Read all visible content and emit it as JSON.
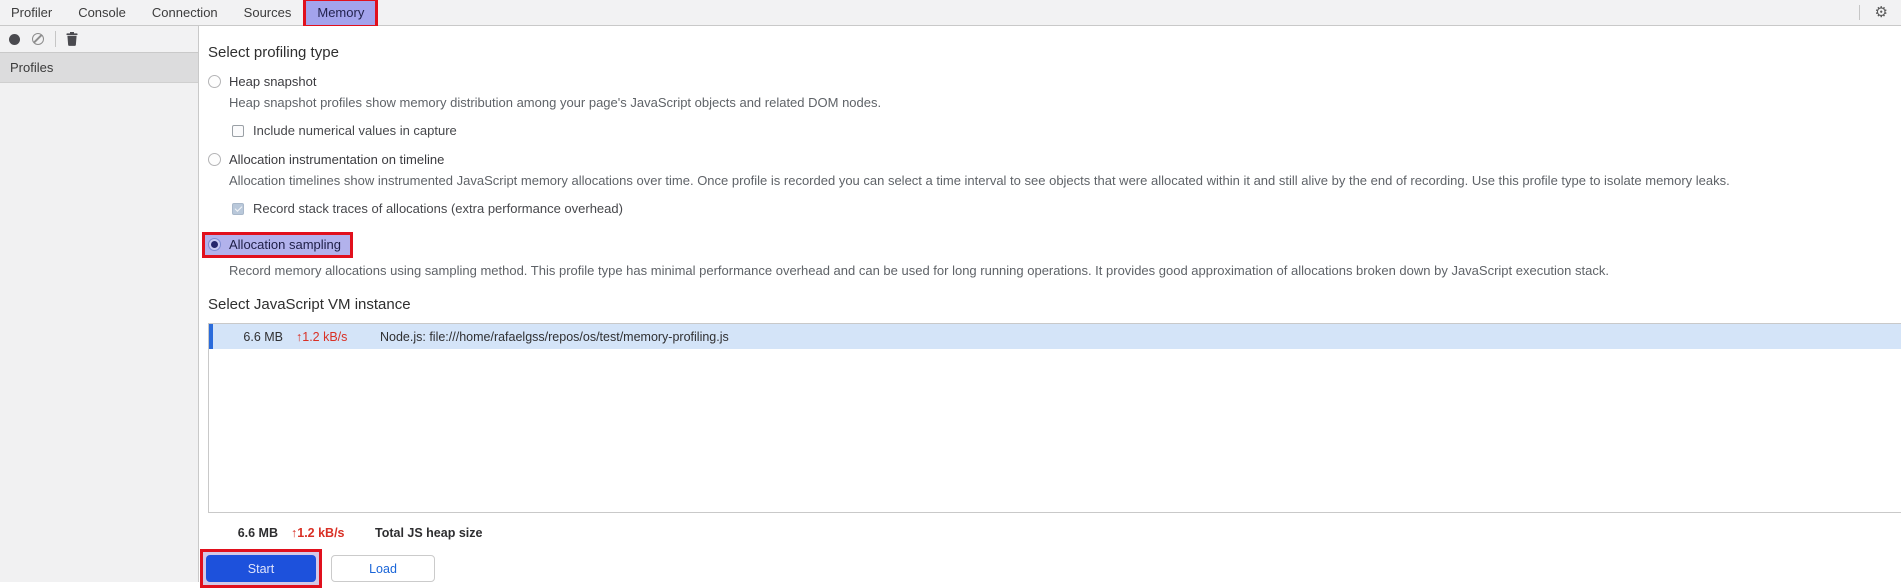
{
  "tabs": {
    "items": [
      {
        "label": "Profiler",
        "active": false
      },
      {
        "label": "Console",
        "active": false
      },
      {
        "label": "Connection",
        "active": false
      },
      {
        "label": "Sources",
        "active": false
      },
      {
        "label": "Memory",
        "active": true
      }
    ]
  },
  "icons": {
    "gear": "⚙"
  },
  "sidebar": {
    "header": "Profiles"
  },
  "main": {
    "profiling_heading": "Select profiling type",
    "options": [
      {
        "label": "Heap snapshot",
        "description": "Heap snapshot profiles show memory distribution among your page's JavaScript objects and related DOM nodes.",
        "checkbox_label": "Include numerical values in capture",
        "checkbox_checked": false,
        "selected": false
      },
      {
        "label": "Allocation instrumentation on timeline",
        "description": "Allocation timelines show instrumented JavaScript memory allocations over time. Once profile is recorded you can select a time interval to see objects that were allocated within it and still alive by the end of recording. Use this profile type to isolate memory leaks.",
        "checkbox_label": "Record stack traces of allocations (extra performance overhead)",
        "checkbox_checked": true,
        "selected": false
      },
      {
        "label": "Allocation sampling",
        "description": "Record memory allocations using sampling method. This profile type has minimal performance overhead and can be used for long running operations. It provides good approximation of allocations broken down by JavaScript execution stack.",
        "selected": true,
        "highlighted": true
      }
    ],
    "vm_heading": "Select JavaScript VM instance",
    "vm_instance": {
      "size": "6.6 MB",
      "rate": "↑1.2 kB/s",
      "name": "Node.js: file:///home/rafaelgss/repos/os/test/memory-profiling.js"
    },
    "totals": {
      "size": "6.6 MB",
      "rate": "↑1.2 kB/s",
      "label": "Total JS heap size"
    },
    "buttons": {
      "start": "Start",
      "load": "Load"
    }
  },
  "colors": {
    "annotation_red": "#e1101d",
    "highlight_lavender": "#b2b2ec",
    "selected_row_blue": "#d4e4f8",
    "row_accent_blue": "#2a6bdb",
    "primary_button_blue": "#1d51dc",
    "rate_red": "#d93025"
  }
}
